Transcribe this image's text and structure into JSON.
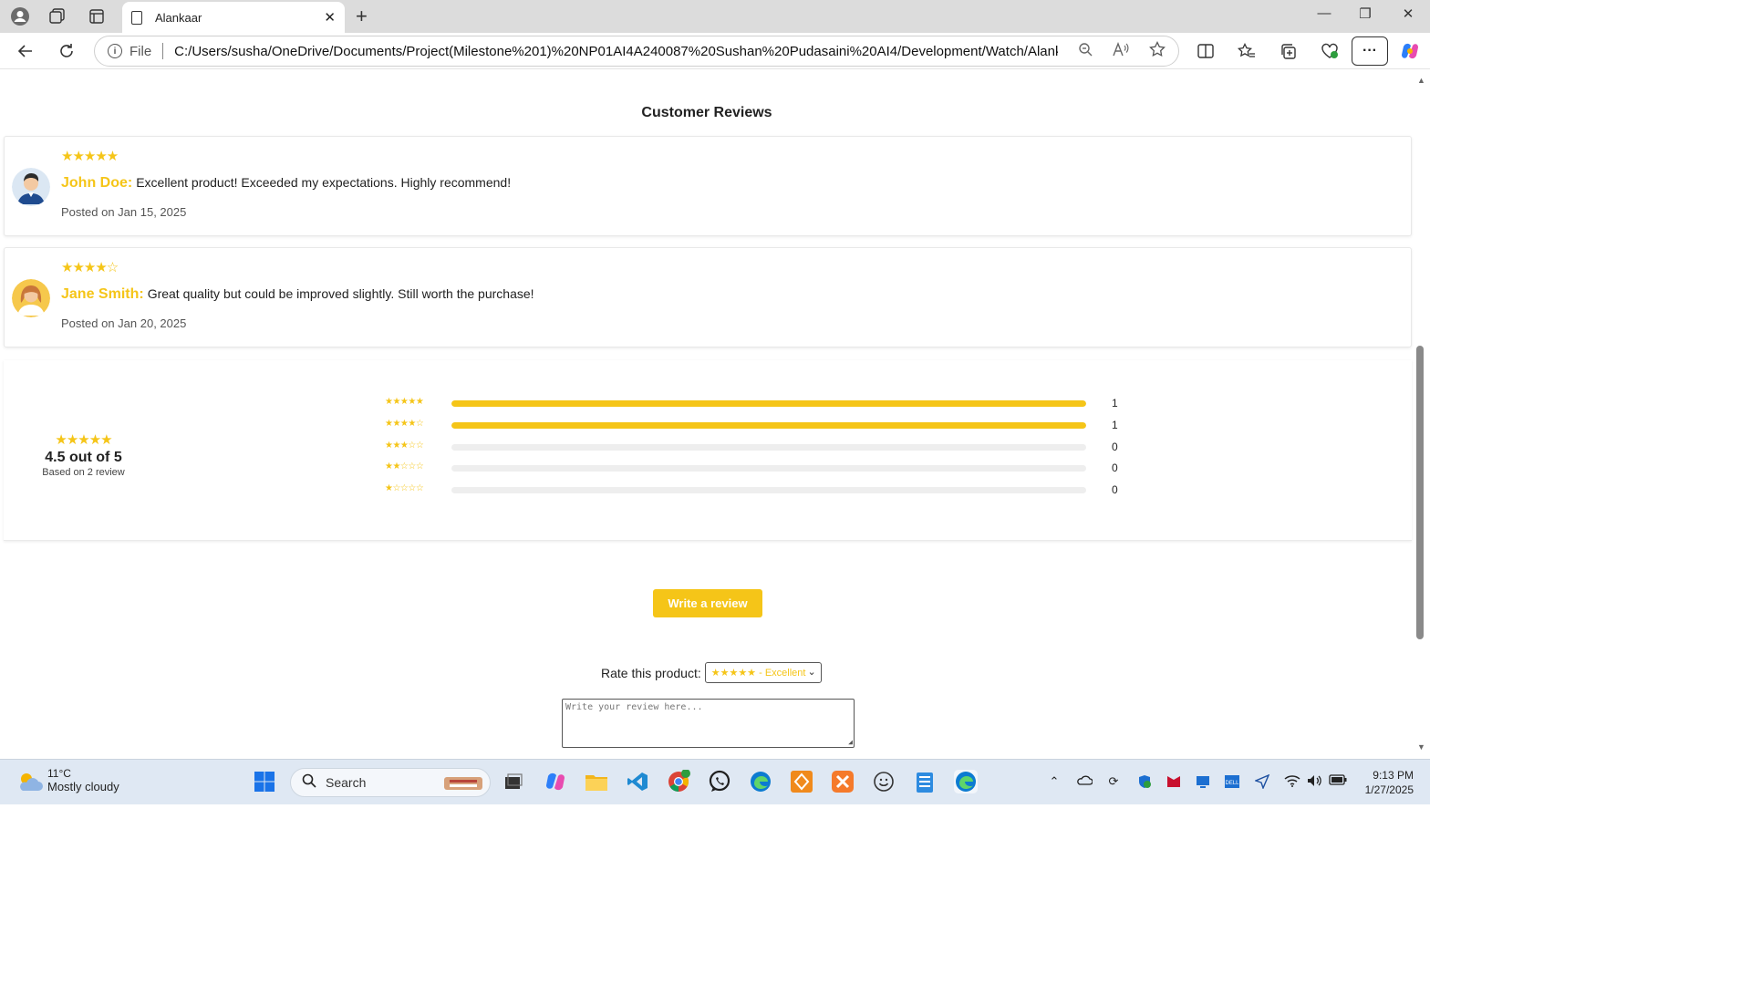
{
  "browser": {
    "tab_title": "Alankaar",
    "url_scheme_label": "File",
    "url": "C:/Users/susha/OneDrive/Documents/Project(Milestone%201)%20NP01AI4A240087%20Sushan%20Pudasaini%20AI4/Development/Watch/Alankaar.html"
  },
  "page": {
    "section_title": "Customer Reviews",
    "reviews": [
      {
        "stars": "★★★★★",
        "rating": 5,
        "name": "John Doe:",
        "text": "Excellent product! Exceeded my expectations. Highly recommend!",
        "date": "Posted on Jan 15, 2025"
      },
      {
        "stars": "★★★★☆",
        "rating": 4.5,
        "name": "Jane Smith:",
        "text": "Great quality but could be improved slightly. Still worth the purchase!",
        "date": "Posted on Jan 20, 2025"
      }
    ],
    "summary": {
      "stars": "★★★★★",
      "average": "4.5 out of 5",
      "based_on": "Based on 2 review",
      "breakdown": [
        {
          "stars": "★★★★★",
          "count": "1",
          "fraction": 1.0
        },
        {
          "stars": "★★★★☆",
          "count": "1",
          "fraction": 1.0
        },
        {
          "stars": "★★★☆☆",
          "count": "0",
          "fraction": 0
        },
        {
          "stars": "★★☆☆☆",
          "count": "0",
          "fraction": 0
        },
        {
          "stars": "★☆☆☆☆",
          "count": "0",
          "fraction": 0
        }
      ]
    },
    "write_review_label": "Write a review",
    "rate_label": "Rate this product:",
    "rate_selected": "★★★★★ - Excellent",
    "review_placeholder": "Write your review here..."
  },
  "taskbar": {
    "temperature": "11°C",
    "condition": "Mostly cloudy",
    "search_label": "Search",
    "time": "9:13 PM",
    "date": "1/27/2025"
  },
  "colors": {
    "accent": "#f5c518",
    "track": "#eeeeee"
  }
}
